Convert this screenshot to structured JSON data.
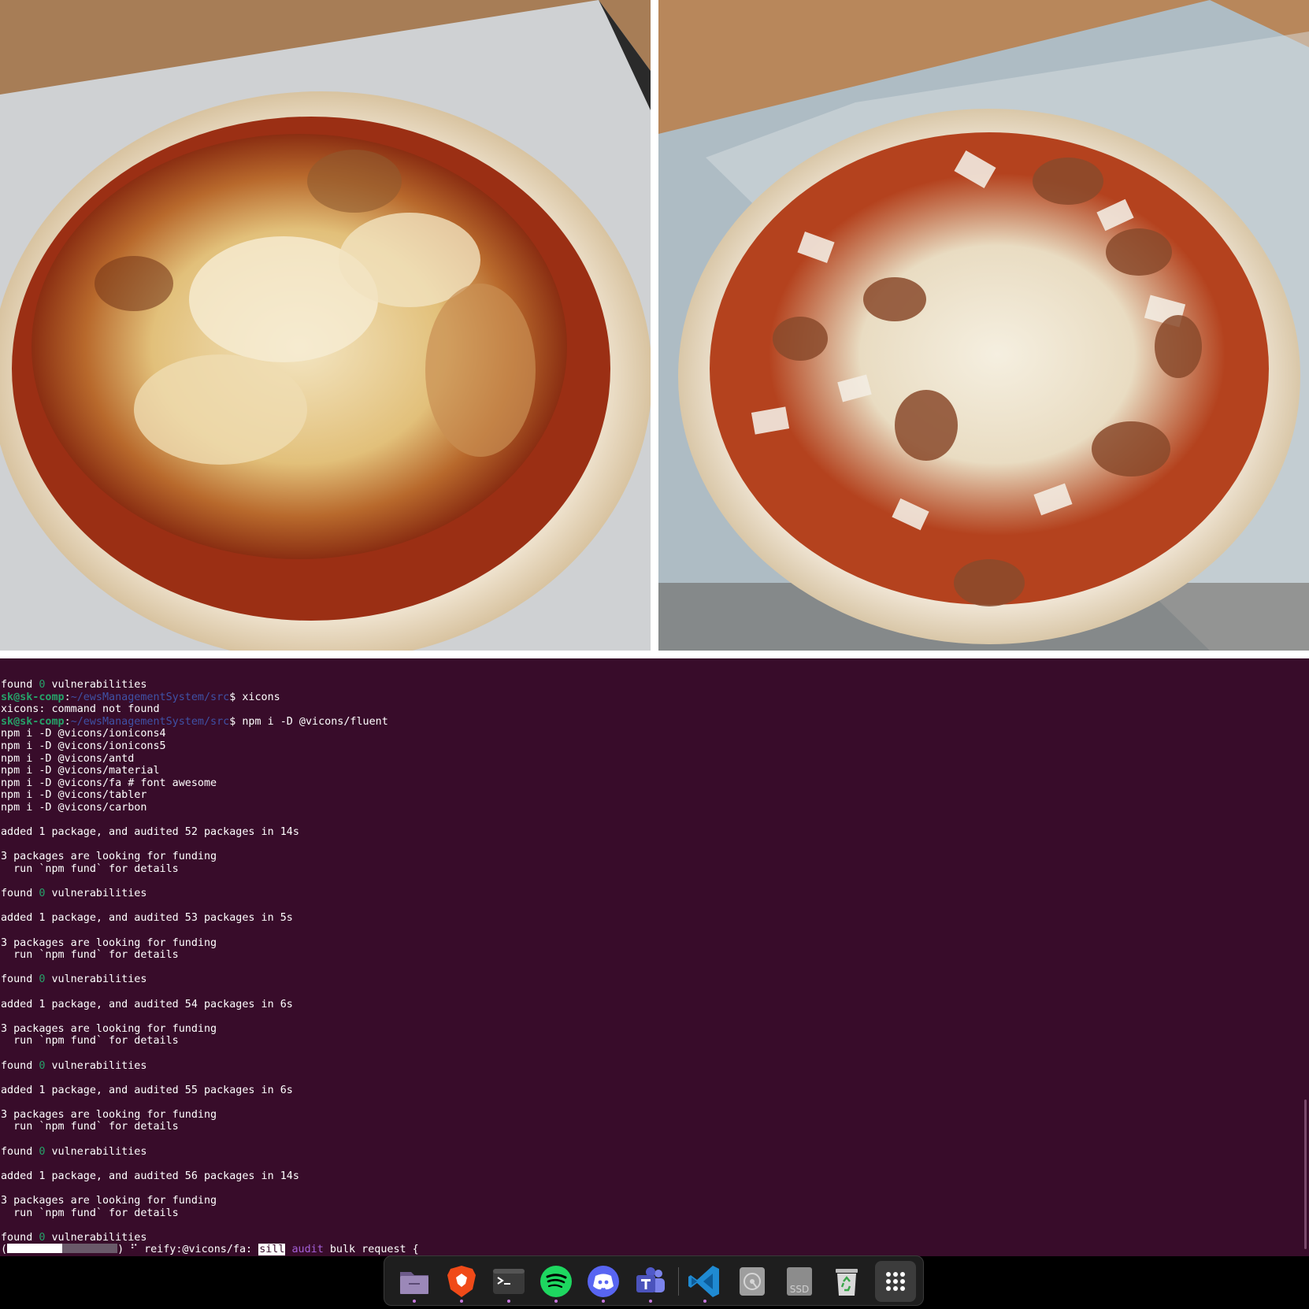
{
  "terminal": {
    "prompt_user": "sk@sk-comp",
    "prompt_path": "~/ewsManagementSystem/src",
    "lines": [
      {
        "type": "text",
        "text": "found ",
        "num": "0",
        "rest": " vulnerabilities"
      },
      {
        "type": "prompt",
        "cmd": "xicons"
      },
      {
        "type": "plain",
        "text": "xicons: command not found"
      },
      {
        "type": "prompt",
        "cmd": "npm i -D @vicons/fluent"
      },
      {
        "type": "plain",
        "text": "npm i -D @vicons/ionicons4"
      },
      {
        "type": "plain",
        "text": "npm i -D @vicons/ionicons5"
      },
      {
        "type": "plain",
        "text": "npm i -D @vicons/antd"
      },
      {
        "type": "plain",
        "text": "npm i -D @vicons/material"
      },
      {
        "type": "plain",
        "text": "npm i -D @vicons/fa # font awesome"
      },
      {
        "type": "plain",
        "text": "npm i -D @vicons/tabler"
      },
      {
        "type": "plain",
        "text": "npm i -D @vicons/carbon"
      },
      {
        "type": "plain",
        "text": ""
      },
      {
        "type": "plain",
        "text": "added 1 package, and audited 52 packages in 14s"
      },
      {
        "type": "plain",
        "text": ""
      },
      {
        "type": "plain",
        "text": "3 packages are looking for funding"
      },
      {
        "type": "plain",
        "text": "  run `npm fund` for details"
      },
      {
        "type": "plain",
        "text": ""
      },
      {
        "type": "text",
        "text": "found ",
        "num": "0",
        "rest": " vulnerabilities"
      },
      {
        "type": "plain",
        "text": ""
      },
      {
        "type": "plain",
        "text": "added 1 package, and audited 53 packages in 5s"
      },
      {
        "type": "plain",
        "text": ""
      },
      {
        "type": "plain",
        "text": "3 packages are looking for funding"
      },
      {
        "type": "plain",
        "text": "  run `npm fund` for details"
      },
      {
        "type": "plain",
        "text": ""
      },
      {
        "type": "text",
        "text": "found ",
        "num": "0",
        "rest": " vulnerabilities"
      },
      {
        "type": "plain",
        "text": ""
      },
      {
        "type": "plain",
        "text": "added 1 package, and audited 54 packages in 6s"
      },
      {
        "type": "plain",
        "text": ""
      },
      {
        "type": "plain",
        "text": "3 packages are looking for funding"
      },
      {
        "type": "plain",
        "text": "  run `npm fund` for details"
      },
      {
        "type": "plain",
        "text": ""
      },
      {
        "type": "text",
        "text": "found ",
        "num": "0",
        "rest": " vulnerabilities"
      },
      {
        "type": "plain",
        "text": ""
      },
      {
        "type": "plain",
        "text": "added 1 package, and audited 55 packages in 6s"
      },
      {
        "type": "plain",
        "text": ""
      },
      {
        "type": "plain",
        "text": "3 packages are looking for funding"
      },
      {
        "type": "plain",
        "text": "  run `npm fund` for details"
      },
      {
        "type": "plain",
        "text": ""
      },
      {
        "type": "text",
        "text": "found ",
        "num": "0",
        "rest": " vulnerabilities"
      },
      {
        "type": "plain",
        "text": ""
      },
      {
        "type": "plain",
        "text": "added 1 package, and audited 56 packages in 14s"
      },
      {
        "type": "plain",
        "text": ""
      },
      {
        "type": "plain",
        "text": "3 packages are looking for funding"
      },
      {
        "type": "plain",
        "text": "  run `npm fund` for details"
      },
      {
        "type": "plain",
        "text": ""
      },
      {
        "type": "text",
        "text": "found ",
        "num": "0",
        "rest": " vulnerabilities"
      }
    ],
    "progress": {
      "fraction": 0.5,
      "open": "(",
      "close": ")",
      "spinner": "⠋",
      "label": "reify:@vicons/fa:",
      "level": "sill",
      "section": "audit",
      "message": "bulk request {"
    }
  },
  "dock": {
    "items": [
      {
        "name": "files-icon",
        "running": true
      },
      {
        "name": "brave-browser-icon",
        "running": true
      },
      {
        "name": "terminal-icon",
        "running": true
      },
      {
        "name": "spotify-icon",
        "running": true
      },
      {
        "name": "discord-icon",
        "running": true
      },
      {
        "name": "teams-icon",
        "running": true
      },
      {
        "name": "vscode-icon",
        "running": true
      },
      {
        "name": "disk-icon",
        "running": false
      },
      {
        "name": "ssd-drive-icon",
        "running": false,
        "label": "SSD"
      },
      {
        "name": "trash-icon",
        "running": false
      },
      {
        "name": "show-apps-grid-icon",
        "running": false
      }
    ]
  },
  "colors": {
    "terminal_bg": "#380c2a",
    "prompt_green": "#26a269",
    "prompt_blue": "#3f51a5",
    "running_dot": "#c678dd"
  }
}
